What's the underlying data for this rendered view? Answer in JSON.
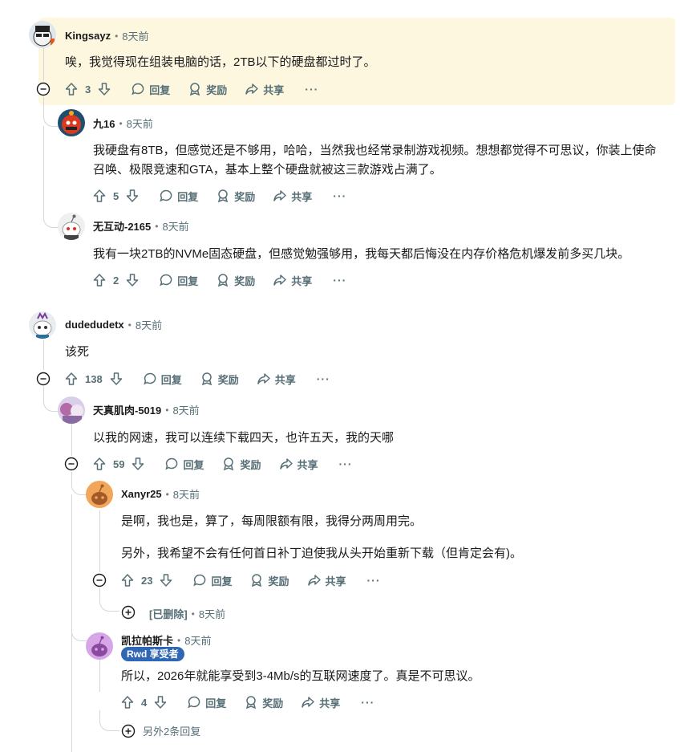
{
  "labels": {
    "reply": "回复",
    "award": "奖励",
    "share": "共享",
    "more": "···"
  },
  "comments": [
    {
      "author": "Kingsayz",
      "time": "8天前",
      "text": "唉，我觉得现在组装电脑的话，2TB以下的硬盘都过时了。",
      "score": "3"
    },
    {
      "author": "九16",
      "time": "8天前",
      "text": "我硬盘有8TB，但感觉还是不够用，哈哈，当然我也经常录制游戏视频。想想都觉得不可思议，你装上使命召唤、极限竞速和GTA，基本上整个硬盘就被这三款游戏占满了。",
      "score": "5"
    },
    {
      "author": "无互动-2165",
      "time": "8天前",
      "text": "我有一块2TB的NVMe固态硬盘，但感觉勉强够用，我每天都后悔没在内存价格危机爆发前多买几块。",
      "score": "2"
    },
    {
      "author": "dudedudetx",
      "time": "8天前",
      "text": "该死",
      "score": "138"
    },
    {
      "author": "天真肌肉-5019",
      "time": "8天前",
      "text": "以我的网速，我可以连续下载四天，也许五天，我的天哪",
      "score": "59"
    },
    {
      "author": "Xanyr25",
      "time": "8天前",
      "text1": "是啊，我也是，算了，每周限额有限，我得分两周用完。",
      "text2": "另外，我希望不会有任何首日补丁迫使我从头开始重新下载（但肯定会有)。",
      "score": "23"
    },
    {
      "author": "[已删除]",
      "time": "8天前"
    },
    {
      "author": "凯拉帕斯卡",
      "time": "8天前",
      "flair": "Rwd 享受者",
      "text": "所以，2026年就能享受到3-4Mb/s的互联网速度了。真是不可思议。",
      "score": "4"
    }
  ],
  "more_replies": "另外2条回复",
  "colors": {
    "highlight": "#fdf7e0",
    "meta": "#576f76",
    "flair": "#2f67b5",
    "thread": "#d4d7d9"
  }
}
